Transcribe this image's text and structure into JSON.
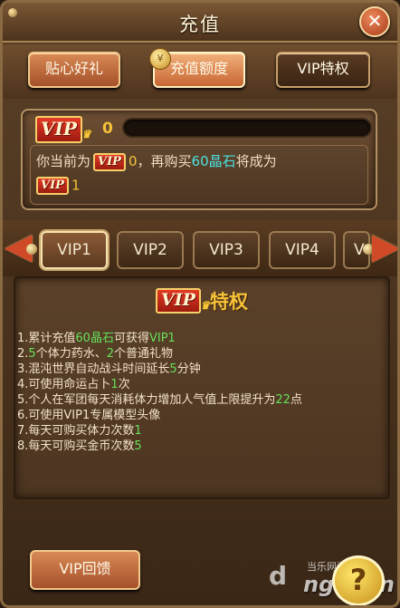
{
  "header": {
    "title": "充值",
    "close_glyph": "✕"
  },
  "top_tabs": [
    {
      "label": "贴心好礼"
    },
    {
      "label": "充值额度"
    },
    {
      "label": "VIP特权"
    }
  ],
  "status": {
    "vip_badge": "VIP",
    "current_level": "0",
    "progress_fraction": 0,
    "line1": {
      "prefix": "你当前为",
      "vip_badge": "VIP",
      "level": "0",
      "middle": "，再购买",
      "amount": "60晶石",
      "suffix": "将成为"
    },
    "line2": {
      "vip_badge": "VIP",
      "level": "1"
    }
  },
  "vip_tabs": [
    {
      "label": "VIP1"
    },
    {
      "label": "VIP2"
    },
    {
      "label": "VIP3"
    },
    {
      "label": "VIP4"
    },
    {
      "label": "V"
    }
  ],
  "perks": {
    "badge": "VIP",
    "title": "特权",
    "items": [
      {
        "a": "1.累计充值",
        "b": "60晶石",
        "c": "可获得",
        "d": "VIP1",
        "e": ""
      },
      {
        "a": "2.",
        "b": "5",
        "c": "个体力药水、",
        "d": "2",
        "e": "个普通礼物"
      },
      {
        "a": "3.混沌世界自动战斗时间延长",
        "b": "5",
        "c": "分钟",
        "d": "",
        "e": ""
      },
      {
        "a": "4.可使用命运占卜",
        "b": "1",
        "c": "次",
        "d": "",
        "e": ""
      },
      {
        "a": "5.个人在军团每天消耗体力增加人气值上限提升为",
        "b": "22",
        "c": "点",
        "d": "",
        "e": ""
      },
      {
        "a": "6.可使用VIP1专属模型头像",
        "b": "",
        "c": "",
        "d": "",
        "e": ""
      },
      {
        "a": "7.每天可购买体力次数",
        "b": "1",
        "c": "",
        "d": "",
        "e": ""
      },
      {
        "a": "8.每天可购买金币次数",
        "b": "5",
        "c": "",
        "d": "",
        "e": ""
      }
    ]
  },
  "bottom": {
    "feedback_label": "VIP回馈",
    "help_glyph": "?",
    "watermark_small": "当乐网游门户",
    "watermark_big": "ng.d.cn",
    "watermark_icon": "d"
  },
  "colors": {
    "highlight_green": "#66e05a",
    "highlight_cyan": "#4de0e0",
    "highlight_gold": "#f6c23a"
  }
}
